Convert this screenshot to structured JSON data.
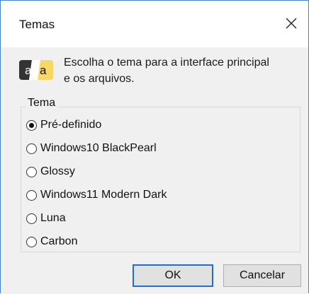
{
  "dialog": {
    "title": "Temas",
    "description": "Escolha o tema para a interface principal e os arquivos.",
    "icon_letters": [
      "a",
      "a"
    ],
    "group_label": "Tema",
    "options": [
      {
        "label": "Pré-definido",
        "checked": true
      },
      {
        "label": "Windows10 BlackPearl",
        "checked": false
      },
      {
        "label": "Glossy",
        "checked": false
      },
      {
        "label": "Windows11 Modern Dark",
        "checked": false
      },
      {
        "label": "Luna",
        "checked": false
      },
      {
        "label": "Carbon",
        "checked": false
      }
    ],
    "ok_label": "OK",
    "cancel_label": "Cancelar"
  },
  "colors": {
    "window_border": "#4a83c9",
    "default_button_border": "#1e6fd1",
    "body_background": "#f0f0f0"
  },
  "icons": {
    "close": "close-icon",
    "theme": "theme-aa-icon"
  }
}
